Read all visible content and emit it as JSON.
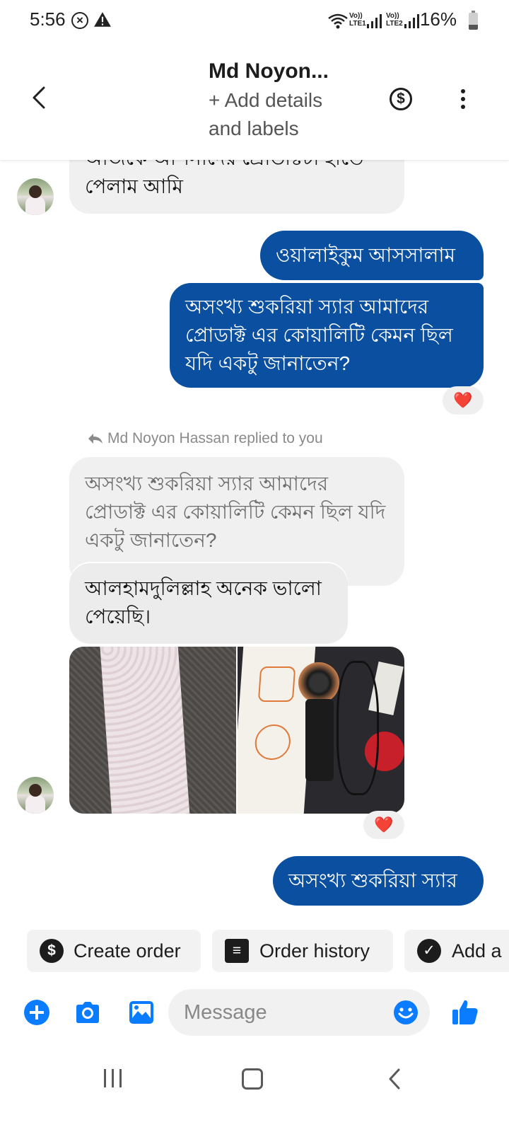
{
  "status_bar": {
    "time": "5:56",
    "lte1_top": "Vo))",
    "lte1_bottom": "LTE1",
    "lte2_top": "Vo))",
    "lte2_bottom": "LTE2",
    "battery": "16%",
    "icons": [
      "close-circle-icon",
      "warning-icon",
      "wifi-icon",
      "signal-icon",
      "battery-icon"
    ]
  },
  "header": {
    "contact_name": "Md Noyon...",
    "add_details": "+ Add details and labels",
    "dollar_symbol": "$",
    "icons": [
      "back-arrow-icon",
      "dollar-circle-icon",
      "more-vertical-icon"
    ]
  },
  "messages": {
    "m1_partial": "আজকে আপনাদের প্রোডাক্টটা হাতে",
    "m1_last": "পেলাম আমি",
    "m2": "ওয়ালাইকুম আসসালাম",
    "m3": "অসংখ্য শুকরিয়া স্যার আমাদের প্রোডাক্ট এর কোয়ালিটি কেমন ছিল যদি একটু জানাতেন?",
    "reply_note": "Md Noyon Hassan replied to you",
    "quoted": "অসংখ্য শুকরিয়া স্যার আমাদের প্রোডাক্ট এর কোয়ালিটি কেমন ছিল যদি একটু জানাতেন?",
    "m4": "আলহামদুলিল্লাহ অনেক ভালো পেয়েছি।",
    "m5": "অসংখ্য শুকরিয়া স্যার",
    "reaction": "❤️"
  },
  "chips": [
    {
      "label": "Create order",
      "icon": "dollar-circle-icon",
      "glyph": "$"
    },
    {
      "label": "Order history",
      "icon": "list-document-icon",
      "glyph": "≡"
    },
    {
      "label": "Add a",
      "icon": "check-circle-icon",
      "glyph": "✓"
    }
  ],
  "composer": {
    "placeholder": "Message",
    "icons": [
      "plus-circle-icon",
      "camera-icon",
      "gallery-icon",
      "emoji-icon",
      "thumbs-up-icon"
    ]
  },
  "colors": {
    "outgoing_bubble": "#0a4fa0",
    "incoming_bubble": "#f0f0f0",
    "accent": "#0a7cff",
    "heart": "#e0112a"
  }
}
